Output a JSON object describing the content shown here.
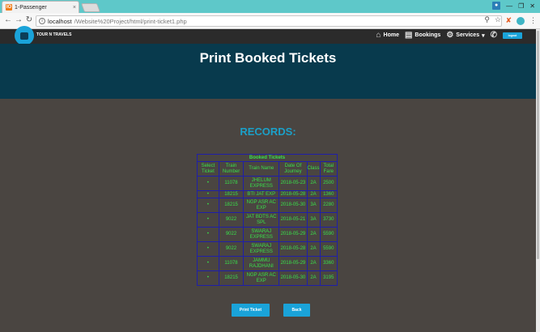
{
  "browser": {
    "tab_title": "1-Passenger",
    "tab_close": "×",
    "favicon": "IO",
    "url_host": "localhost",
    "url_path": "/Website%20Project/html/print-ticket1.php",
    "back": "←",
    "forward": "→",
    "reload": "C",
    "info": "i",
    "zoom": "⚲",
    "star": "☆",
    "menu": "⋮",
    "win_user": "👤",
    "win_min": "—",
    "win_max": "❐",
    "win_close": "✕"
  },
  "nav": {
    "brand": "TOUR N TRAVELS",
    "home": "Home",
    "bookings": "Bookings",
    "services": "Services",
    "services_caret": "▾",
    "logout": "logout",
    "home_icon": "⌂",
    "bookings_icon": "▤",
    "services_icon": "⚙",
    "phone_icon": "✆"
  },
  "hero": {
    "title": "Print Booked Tickets"
  },
  "main": {
    "records_heading": "RECORDS:",
    "table_caption": "Booked Tickets",
    "columns": [
      "Select Ticket",
      "Train Number",
      "Train Name",
      "Date Of Journey",
      "Class",
      "Total Fare"
    ],
    "rows": [
      {
        "select": "•",
        "number": "11078",
        "name": "JHELUM EXPRESS",
        "date": "2018-05-23",
        "class": "2A",
        "fare": "2500"
      },
      {
        "select": "•",
        "number": "18215",
        "name": "BTI JAT EXP",
        "date": "2018-05-28",
        "class": "2A",
        "fare": "1360"
      },
      {
        "select": "•",
        "number": "18215",
        "name": "NGP ASR AC EXP",
        "date": "2018-05-30",
        "class": "3A",
        "fare": "2280"
      },
      {
        "select": "•",
        "number": "9022",
        "name": "JAT BDTS AC SPL",
        "date": "2018-05-21",
        "class": "3A",
        "fare": "3730"
      },
      {
        "select": "•",
        "number": "9022",
        "name": "SWARAJ EXPRESS",
        "date": "2018-05-29",
        "class": "2A",
        "fare": "5590"
      },
      {
        "select": "•",
        "number": "9022",
        "name": "SWARAJ EXPRESS",
        "date": "2018-05-28",
        "class": "2A",
        "fare": "5590"
      },
      {
        "select": "•",
        "number": "11078",
        "name": "JAMMU RAJDHANI",
        "date": "2018-05-29",
        "class": "2A",
        "fare": "3360"
      },
      {
        "select": "•",
        "number": "18215",
        "name": "NGP ASR AC EXP",
        "date": "2018-05-30",
        "class": "2A",
        "fare": "3195"
      }
    ],
    "print_button": "Print Ticket",
    "back_button": "Back"
  },
  "colors": {
    "page_bg": "#4a4541",
    "hero_bg": "#083a4d",
    "accent": "#1aa3d9",
    "table_text": "#39e04a",
    "table_border": "#1f1fa8"
  }
}
